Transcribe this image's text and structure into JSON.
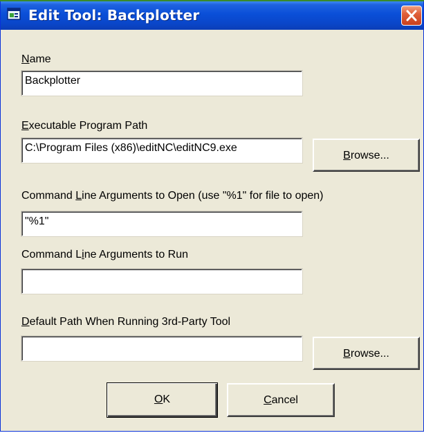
{
  "window": {
    "title": "Edit Tool: Backplotter",
    "icon": "app-window-icon",
    "close_icon": "close-icon"
  },
  "form": {
    "name": {
      "prefix": "",
      "accel": "N",
      "rest": "ame",
      "value": "Backplotter"
    },
    "exe_path": {
      "prefix": "",
      "accel": "E",
      "rest": "xecutable Program Path",
      "value": "C:\\Program Files (x86)\\editNC\\editNC9.exe"
    },
    "browse1": {
      "accel": "B",
      "rest": "rowse..."
    },
    "open_args": {
      "prefix": "Command ",
      "accel": "L",
      "rest": "ine Arguments to Open (use \"%1\" for file to open)",
      "value": "\"%1\""
    },
    "run_args": {
      "prefix": "Command L",
      "accel": "i",
      "rest": "ne Arguments to Run",
      "value": ""
    },
    "default_path": {
      "prefix": "",
      "accel": "D",
      "rest": "efault Path When Running 3rd-Party Tool",
      "value": ""
    },
    "browse2": {
      "accel": "B",
      "rest": "rowse..."
    }
  },
  "buttons": {
    "ok": {
      "accel": "O",
      "rest": "K"
    },
    "cancel": {
      "accel": "C",
      "rest": "ancel"
    }
  }
}
